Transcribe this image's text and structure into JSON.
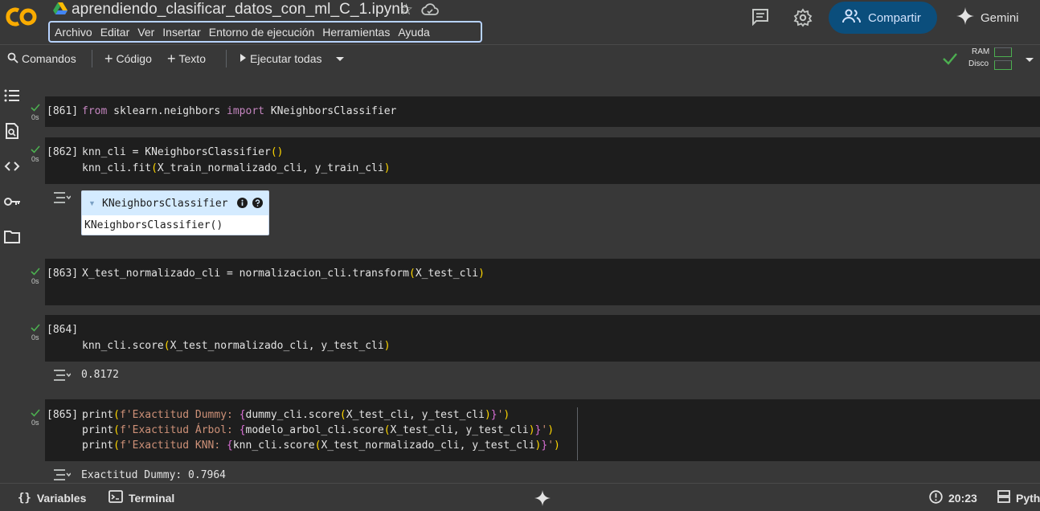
{
  "header": {
    "logo_text": "CO",
    "notebook_title": "aprendiendo_clasificar_datos_con_ml_C_1.ipynb",
    "menu": [
      "Archivo",
      "Editar",
      "Ver",
      "Insertar",
      "Entorno de ejecución",
      "Herramientas",
      "Ayuda"
    ],
    "share_label": "Compartir",
    "gemini_label": "Gemini"
  },
  "toolbar": {
    "commands_label": "Comandos",
    "code_label": "Código",
    "text_label": "Texto",
    "run_all_label": "Ejecutar todas",
    "ram_label": "RAM",
    "disk_label": "Disco"
  },
  "cells": [
    {
      "num": "[861]",
      "time": "0s"
    },
    {
      "num": "[862]",
      "time": "0s"
    },
    {
      "num": "[863]",
      "time": "0s"
    },
    {
      "num": "[864]",
      "time": "0s"
    },
    {
      "num": "[865]",
      "time": "0s"
    }
  ],
  "code": {
    "c861_kw1": "from",
    "c861_mod": " sklearn.neighbors ",
    "c861_kw2": "import",
    "c861_cls": " KNeighborsClassifier",
    "c862_l1a": "knn_cli = KNeighborsClassifier",
    "c862_l1p": "()",
    "c862_l2a": "knn_cli.fit",
    "c862_l2b": "X_train_normalizado_cli, y_train_cli",
    "c863_a": "X_test_normalizado_cli = normalizacion_cli.transform",
    "c863_b": "X_test_cli",
    "c864_a": "knn_cli.score",
    "c864_b": "X_test_normalizado_cli, y_test_cli",
    "c865_l1_fn": "print",
    "c865_l1_str1": "f'Exactitud Dummy: ",
    "c865_l1_expr": "dummy_cli.score",
    "c865_l1_args": "X_test_cli, y_test_cli",
    "c865_l2_fn": "print",
    "c865_l2_str1": "f'Exactitud Árbol: ",
    "c865_l2_expr": "modelo_arbol_cli.score",
    "c865_l2_args": "X_test_cli, y_test_cli",
    "c865_l3_fn": "print",
    "c865_l3_str1": "f'Exactitud KNN: ",
    "c865_l3_expr": "knn_cli.score",
    "c865_l3_args": "X_test_normalizado_cli, y_test_cli"
  },
  "outputs": {
    "estimator_name": "KNeighborsClassifier",
    "estimator_repr": "KNeighborsClassifier()",
    "score_864": "0.8172",
    "print_865": "Exactitud Dummy: 0.7964"
  },
  "statusbar": {
    "variables_label": "Variables",
    "terminal_label": "Terminal",
    "time": "20:23",
    "runtime_label": "Pyth"
  },
  "colors": {
    "share_bg": "#0b4e7c",
    "check_green": "#4caf50",
    "menubar_border": "#b7d3ff"
  }
}
